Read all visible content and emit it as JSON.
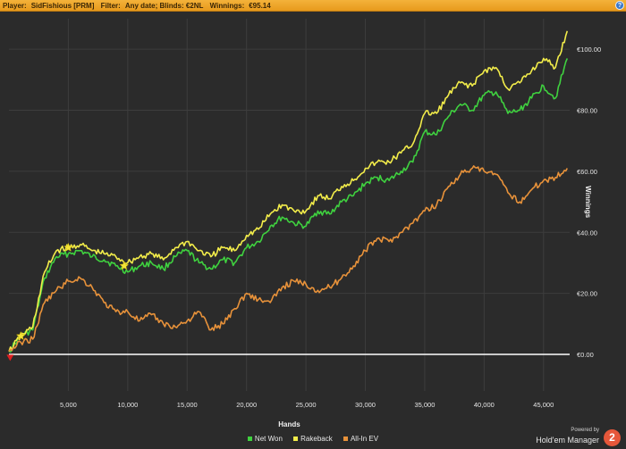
{
  "header": {
    "player_label": "Player:",
    "player_value": "SidFishious [PRM]",
    "filter_label": "Filter:",
    "filter_value": "Any date; Blinds: €2NL",
    "winnings_label": "Winnings:",
    "winnings_value": "€95.14",
    "help_icon": "?"
  },
  "chart_data": {
    "type": "line",
    "title": "",
    "xlabel": "Hands",
    "ylabel": "Winnings",
    "xlim": [
      0,
      47200
    ],
    "ylim": [
      -12,
      110
    ],
    "x_ticks": [
      5000,
      10000,
      15000,
      20000,
      25000,
      30000,
      35000,
      40000,
      45000
    ],
    "x_tick_labels": [
      "5,000",
      "10,000",
      "15,000",
      "20,000",
      "25,000",
      "30,000",
      "35,000",
      "40,000",
      "45,000"
    ],
    "y_ticks": [
      0,
      20,
      40,
      60,
      80,
      100
    ],
    "y_tick_labels": [
      "€0.00",
      "€20.00",
      "€40.00",
      "€60.00",
      "€80.00",
      "€100.00"
    ],
    "y_axis_side": "right",
    "grid": true,
    "legend_position": "bottom",
    "series": [
      {
        "name": "Net Won",
        "color": "#3fd13f",
        "x": [
          0,
          1000,
          2000,
          3000,
          4000,
          5000,
          6000,
          7000,
          8000,
          9000,
          10000,
          11000,
          12000,
          13000,
          14000,
          15000,
          16000,
          17000,
          18000,
          19000,
          20000,
          21000,
          22000,
          23000,
          24000,
          25000,
          26000,
          27000,
          28000,
          29000,
          30000,
          31000,
          32000,
          33000,
          34000,
          35000,
          36000,
          37000,
          38000,
          39000,
          40000,
          41000,
          42000,
          43000,
          44000,
          45000,
          46000,
          47000
        ],
        "values": [
          1,
          6,
          8,
          25,
          32,
          33,
          34,
          32,
          31,
          29,
          27,
          29,
          30,
          28,
          32,
          34,
          30,
          28,
          31,
          30,
          35,
          37,
          42,
          45,
          43,
          42,
          47,
          46,
          50,
          52,
          56,
          58,
          57,
          60,
          63,
          73,
          72,
          78,
          82,
          80,
          85,
          86,
          79,
          80,
          84,
          88,
          84,
          97
        ]
      },
      {
        "name": "Rakeback",
        "color": "#f2ec4a",
        "x": [
          0,
          1000,
          2000,
          3000,
          4000,
          5000,
          6000,
          7000,
          8000,
          9000,
          10000,
          11000,
          12000,
          13000,
          14000,
          15000,
          16000,
          17000,
          18000,
          19000,
          20000,
          21000,
          22000,
          23000,
          24000,
          25000,
          26000,
          27000,
          28000,
          29000,
          30000,
          31000,
          32000,
          33000,
          34000,
          35000,
          36000,
          37000,
          38000,
          39000,
          40000,
          41000,
          42000,
          43000,
          44000,
          45000,
          46000,
          47000
        ],
        "values": [
          1,
          6,
          9,
          27,
          34,
          35,
          36,
          34,
          33,
          32,
          30,
          32,
          33,
          31,
          35,
          37,
          34,
          32,
          35,
          34,
          39,
          41,
          46,
          49,
          47,
          47,
          52,
          51,
          55,
          57,
          61,
          63,
          63,
          66,
          69,
          79,
          79,
          85,
          89,
          88,
          93,
          94,
          87,
          89,
          93,
          97,
          94,
          106
        ]
      },
      {
        "name": "All-In EV",
        "color": "#e8923a",
        "x": [
          0,
          1000,
          2000,
          3000,
          4000,
          5000,
          6000,
          7000,
          8000,
          9000,
          10000,
          11000,
          12000,
          13000,
          14000,
          15000,
          16000,
          17000,
          18000,
          19000,
          20000,
          21000,
          22000,
          23000,
          24000,
          25000,
          26000,
          27000,
          28000,
          29000,
          30000,
          31000,
          32000,
          33000,
          34000,
          35000,
          36000,
          37000,
          38000,
          39000,
          40000,
          41000,
          42000,
          43000,
          44000,
          45000,
          46000,
          47000
        ],
        "values": [
          1,
          4,
          5,
          17,
          21,
          24,
          25,
          22,
          17,
          14,
          14,
          11,
          13,
          10,
          9,
          11,
          14,
          8,
          10,
          15,
          20,
          18,
          17,
          22,
          24,
          23,
          21,
          22,
          25,
          29,
          34,
          38,
          37,
          40,
          43,
          47,
          49,
          55,
          59,
          61,
          60,
          59,
          53,
          50,
          54,
          57,
          58,
          61
        ]
      }
    ],
    "markers": [
      {
        "type": "star",
        "color": "#f4e43a",
        "x": 1000,
        "y": 6
      },
      {
        "type": "star",
        "color": "#f4e43a",
        "x": 5000,
        "y": 35
      },
      {
        "type": "star",
        "color": "#f4e43a",
        "x": 9700,
        "y": 29
      },
      {
        "type": "triangle-down",
        "color": "#e02020",
        "x": 100,
        "y": -1
      }
    ]
  },
  "legend": {
    "items": [
      {
        "label": "Net Won",
        "color": "#3fd13f"
      },
      {
        "label": "Rakeback",
        "color": "#f2ec4a"
      },
      {
        "label": "All-In EV",
        "color": "#e8923a"
      }
    ]
  },
  "branding": {
    "powered_by": "Powered by",
    "product": "Hold'em Manager",
    "logo_text": "2"
  },
  "colors": {
    "background": "#2b2b2b",
    "plot_background": "#2b2b2b",
    "grid": "#3d3d3d",
    "zero_line": "#ffffff",
    "header": "#f0a62b"
  }
}
